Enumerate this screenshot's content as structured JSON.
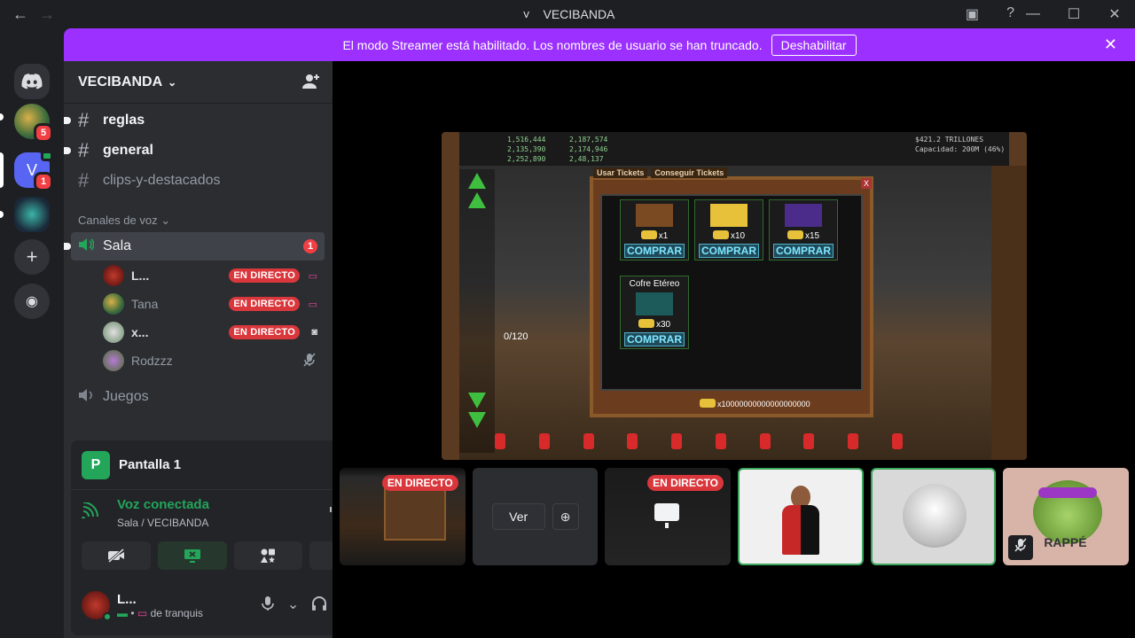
{
  "titlebar": {
    "back_icon": "←",
    "forward_icon": "→",
    "server_initial": "V",
    "title": "VECIBANDA",
    "minimize": "—",
    "maximize": "☐",
    "close": "✕",
    "inbox_icon": "▣",
    "help_icon": "?"
  },
  "rail": {
    "home_icon": "discord-logo",
    "servers": [
      {
        "name": "server-a",
        "badge": "5"
      },
      {
        "name": "server-vecibanda",
        "initial": "V",
        "badge": "1"
      },
      {
        "name": "server-c"
      }
    ],
    "add_icon": "+",
    "explore_icon": "◉"
  },
  "banner": {
    "text": "El modo Streamer está habilitado. Los nombres de usuario se han truncado.",
    "button": "Deshabilitar",
    "close": "✕"
  },
  "sidebar": {
    "guild_name": "VECIBANDA",
    "chevron": "⌄",
    "invite_icon": "👤+",
    "text_channels": [
      {
        "name": "reglas",
        "unread": true
      },
      {
        "name": "general",
        "unread": true
      },
      {
        "name": "clips-y-destacados",
        "unread": false
      }
    ],
    "voice_category": "Canales de voz",
    "voice_channels": [
      {
        "name": "Sala",
        "mentions": "1",
        "active": true
      },
      {
        "name": "Juegos",
        "mentions": "",
        "active": false
      }
    ],
    "voice_users": [
      {
        "name": "L...",
        "live": "EN DIRECTO"
      },
      {
        "name": "Tana",
        "live": "EN DIRECTO"
      },
      {
        "name": "x...",
        "live": "EN DIRECTO"
      },
      {
        "name": "Rodzzz",
        "live": ""
      }
    ]
  },
  "rtc": {
    "screen_avatar": "P",
    "screen_name": "Pantalla 1",
    "status": "Voz conectada",
    "location": "Sala / VECIBANDA"
  },
  "user_panel": {
    "name": "L...",
    "status": "de tranquis"
  },
  "game": {
    "counter": "0/120",
    "tabs": [
      "Usar Tickets",
      "Conseguir Tickets"
    ],
    "items": [
      {
        "cost": "x1",
        "buy": "COMPRAR"
      },
      {
        "cost": "x10",
        "buy": "COMPRAR"
      },
      {
        "cost": "x15",
        "buy": "COMPRAR"
      },
      {
        "title": "Cofre Etéreo",
        "cost": "x30",
        "buy": "COMPRAR"
      }
    ],
    "footer": "x10000000000000000000",
    "top_left": [
      "1,516,444",
      "2,135,390",
      "2,252,890"
    ],
    "top_mid": [
      "2,187,574",
      "2,174,946",
      "2,48,137"
    ],
    "top_right": [
      "$421.2 TRILLONES",
      "Capacidad: 200M (46%)"
    ]
  },
  "thumbs": {
    "live_label": "EN DIRECTO",
    "ver_label": "Ver",
    "frog_text": "RAPPÉ"
  },
  "colors": {
    "accent": "#5865f2",
    "banner": "#9b30ff",
    "live": "#da373c",
    "connected": "#23a55a"
  }
}
